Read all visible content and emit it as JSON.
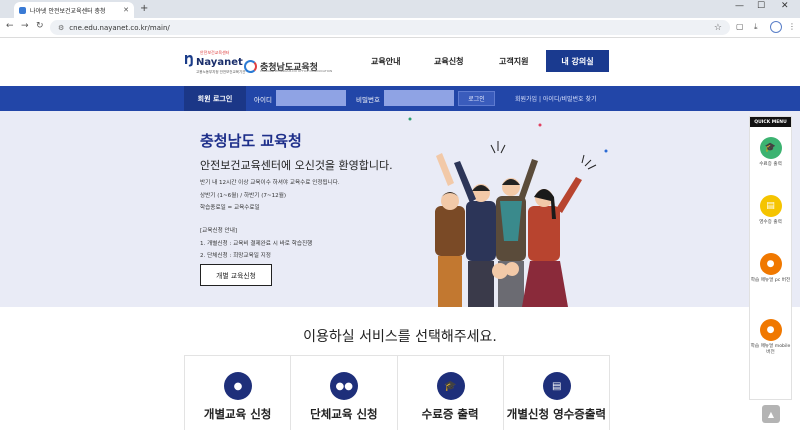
{
  "browser": {
    "tab_title": "나야넷 안전보건교육센터 충청",
    "new_tab": "+",
    "url": "cne.edu.nayanet.co.kr/main/",
    "controls": {
      "minimize": "—",
      "maximize": "☐",
      "close": "✕"
    }
  },
  "header": {
    "logo1_main": "Nayanet",
    "logo1_sup": "안전보건교육센터",
    "logo1_sub": "고용노동부지정 안전보건교육기관",
    "logo2_text": "충청남도교육청",
    "logo2_sub": "CHUNGCHEONGNAM-DO OFFICE OF EDUCATION",
    "menu": [
      "교육안내",
      "교육신청",
      "고객지원"
    ],
    "my_room": "내 강의실"
  },
  "login": {
    "title": "회원 로그인",
    "id_label": "아이디",
    "pw_label": "비밀번호",
    "button": "로그인",
    "links": "회원가입 | 아이디/비밀번호 찾기"
  },
  "hero": {
    "title": "충청남도 교육청",
    "subtitle": "안전보건교육센터에 오신것을 환영합니다.",
    "lines": [
      "반기 내 12시간 이상 교육이수 하셔야 교육수료 인정됩니다.",
      "상반기 (1~6월) / 하반기 (7~12월)",
      "학습종료일 = 교육수료일",
      "",
      "[교육신청 안내]",
      "1. 개별신청 : 교육비 결제완료 시 바로 학습진행",
      "2. 단체신청 : 희망교육일 지정"
    ],
    "button": "개별 교육신청"
  },
  "quick_menu": {
    "title": "QUICK MENU",
    "items": [
      {
        "label": "수료증 출력",
        "icon": "graduation-cap-icon",
        "color": "#3cb371"
      },
      {
        "label": "영수증 출력",
        "icon": "receipt-icon",
        "color": "#f5c400"
      },
      {
        "label": "학습 매뉴얼 pc 버전",
        "icon": "chat-icon",
        "color": "#f07800"
      },
      {
        "label": "학습 매뉴얼 mobile 버전",
        "icon": "chat-icon",
        "color": "#f07800"
      }
    ]
  },
  "services": {
    "title": "이용하실 서비스를 선택해주세요.",
    "cards": [
      {
        "label": "개별교육 신청",
        "icon": "user-icon"
      },
      {
        "label": "단체교육 신청",
        "icon": "group-icon"
      },
      {
        "label": "수료증 출력",
        "icon": "graduation-cap-icon"
      },
      {
        "label": "개별신청 영수증출력",
        "icon": "document-icon"
      }
    ]
  },
  "colors": {
    "brand": "#1a3a8f",
    "login_bar": "#2246a8",
    "hero_bg": "#e9ebf6"
  }
}
